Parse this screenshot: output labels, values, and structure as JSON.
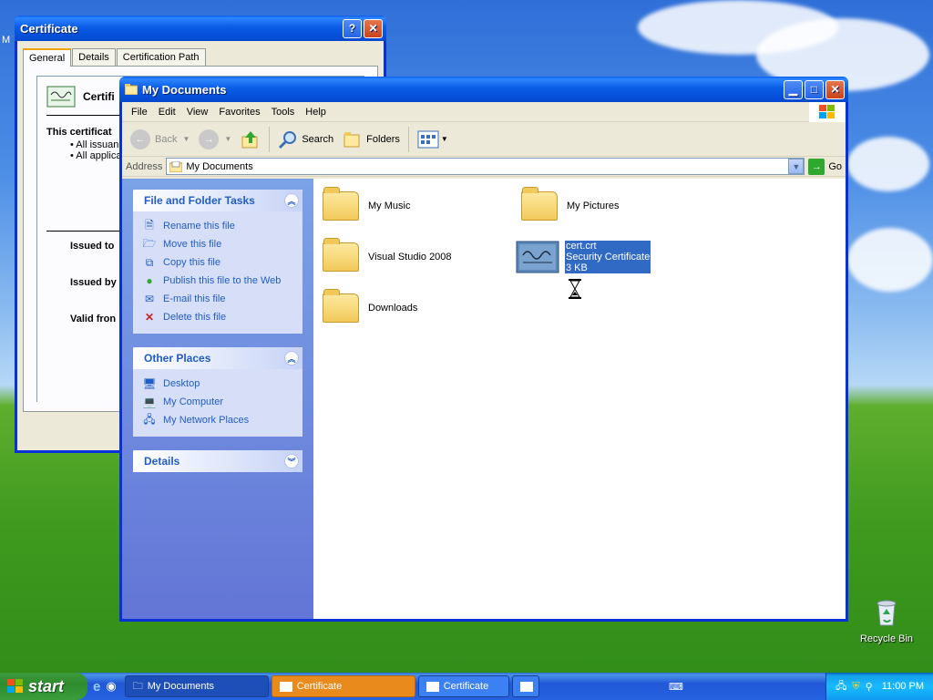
{
  "desktop": {
    "recycle_bin_label": "Recycle Bin",
    "top_left_label": "M"
  },
  "cert_window": {
    "title": "Certificate",
    "tabs": [
      "General",
      "Details",
      "Certification Path"
    ],
    "heading": "Certifi",
    "purpose_text": "This certificat",
    "bullets": [
      "• All issuan",
      "• All applica"
    ],
    "issued_to": "Issued to",
    "issued_by": "Issued by",
    "valid_from": "Valid fron"
  },
  "explorer": {
    "title": "My Documents",
    "menu": [
      "File",
      "Edit",
      "View",
      "Favorites",
      "Tools",
      "Help"
    ],
    "toolbar": {
      "back": "Back",
      "search": "Search",
      "folders": "Folders"
    },
    "address_label": "Address",
    "address_value": "My Documents",
    "go_label": "Go",
    "file_tasks": {
      "title": "File and Folder Tasks",
      "items": [
        "Rename this file",
        "Move this file",
        "Copy this file",
        "Publish this file to the Web",
        "E-mail this file",
        "Delete this file"
      ]
    },
    "other_places": {
      "title": "Other Places",
      "items": [
        "Desktop",
        "My Computer",
        "My Network Places"
      ]
    },
    "details_title": "Details",
    "items": [
      {
        "name": "My Music"
      },
      {
        "name": "My Pictures"
      },
      {
        "name": "Visual Studio 2008"
      },
      {
        "name": "cert.crt",
        "type": "Security Certificate",
        "size": "3 KB"
      },
      {
        "name": "Downloads"
      }
    ]
  },
  "taskbar": {
    "start_label": "start",
    "tasks": [
      "My Documents",
      "Certificate",
      "Certificate"
    ],
    "clock": "11:00 PM"
  },
  "colors": {
    "title_blue": "#0a5eea",
    "task_link_blue": "#215dc6",
    "active_task_orange": "#e88a1c",
    "selection_blue": "#316ac5"
  }
}
